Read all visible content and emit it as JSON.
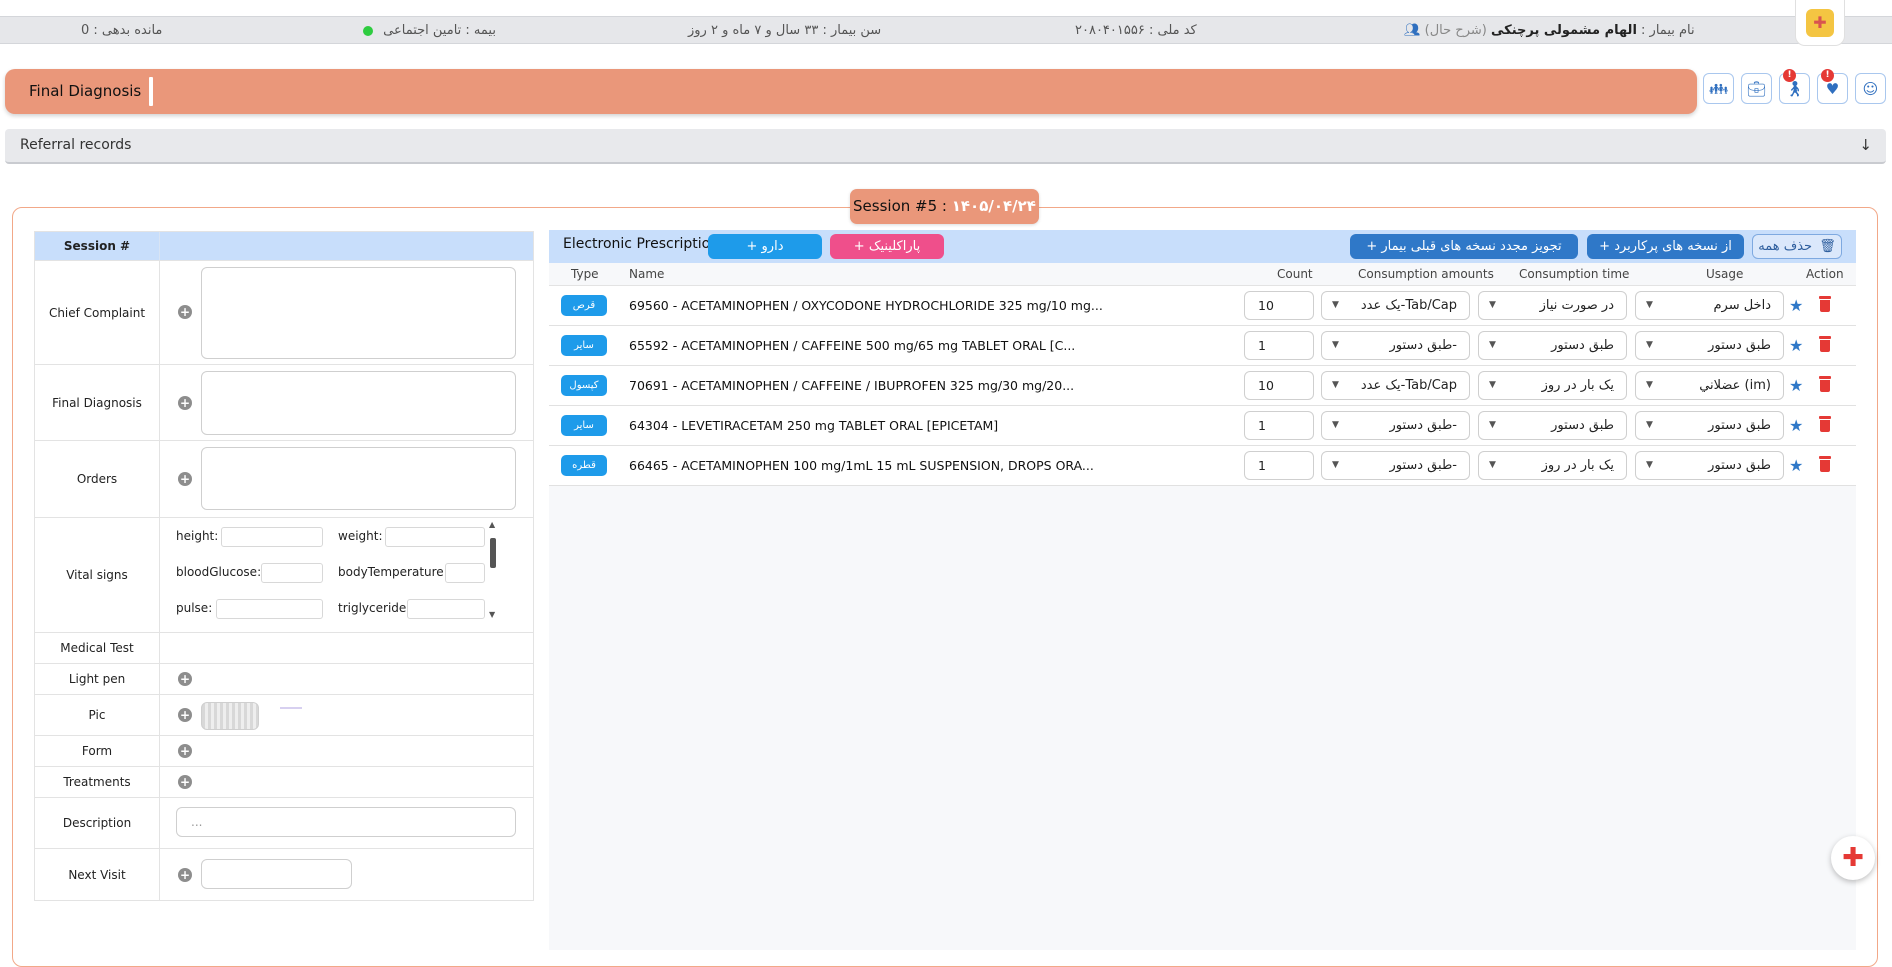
{
  "header": {
    "patient_name_label": "نام بیمار :",
    "patient_name": "الهام مشمولی پرچنکی",
    "history_link": "(شرح حال)",
    "national_code_label": "کد ملی :",
    "national_code": "۲۰۸۰۴۰۱۵۵۶",
    "age_label": "سن بیمار :",
    "age": "۳۳ سال و ۷ ماه و ۲ روز",
    "insurance_label": "بیمه :",
    "insurance": "تامین اجتماعی",
    "debt_label": "مانده بدهی :",
    "debt": "0"
  },
  "diagnosis_bar": {
    "title": "Final Diagnosis"
  },
  "toolbar_icons": [
    {
      "icon": "family-icon",
      "badge": ""
    },
    {
      "icon": "medical-kit-icon",
      "badge": ""
    },
    {
      "icon": "patient-walk-icon",
      "badge": "!"
    },
    {
      "icon": "health-icon",
      "badge": "!"
    },
    {
      "icon": "doctor-icon",
      "badge": ""
    }
  ],
  "referral": {
    "title": "Referral records",
    "arrow": "↓"
  },
  "session": {
    "label": "Session #5 :",
    "date": "۱۴۰۵/۰۴/۲۴"
  },
  "left_table": {
    "header": "Session #",
    "rows": {
      "chief_complaint": "Chief Complaint",
      "final_diagnosis": "Final Diagnosis",
      "orders": "Orders",
      "vital_signs": "Vital signs",
      "medical_test": "Medical Test",
      "light_pen": "Light pen",
      "pic": "Pic",
      "form": "Form",
      "treatments": "Treatments",
      "description": "Description",
      "next_visit": "Next Visit"
    },
    "vitals": {
      "height": "height:",
      "weight": "weight:",
      "blood_glucose": "bloodGlucose:",
      "body_temperature": "bodyTemperature:",
      "pulse": "pulse:",
      "triglyceride": "triglyceride:"
    },
    "description_placeholder": "..."
  },
  "prescription": {
    "title": "Electronic Prescription",
    "buttons": {
      "drug": "+ دارو",
      "paraclinic": "+ پاراکلینیک",
      "renew": "+ تجویز مجدد نسخه های قبلی بیمار",
      "frequent": "+ از نسخه های پرکاربرد",
      "delete_all": "حذف همه"
    },
    "columns": {
      "type": "Type",
      "name": "Name",
      "count": "Count",
      "amounts": "Consumption amounts",
      "time": "Consumption time",
      "usage": "Usage",
      "action": "Action"
    },
    "rows": [
      {
        "type": "قرص",
        "name": "69560 - ACETAMINOPHEN / OXYCODONE HYDROCHLORIDE 325 mg/10 mg...",
        "count": "10",
        "amount": "Tab/Cap-یک عدد",
        "time": "در صورت نیاز",
        "usage": "داخل سرم"
      },
      {
        "type": "سایر",
        "name": "65592 - ACETAMINOPHEN / CAFFEINE 500 mg/65 mg TABLET ORAL [C...",
        "count": "1",
        "amount": "-طبق دستور",
        "time": "طبق دستور",
        "usage": "طبق دستور"
      },
      {
        "type": "کپسول",
        "name": "70691 - ACETAMINOPHEN / CAFFEINE / IBUPROFEN 325 mg/30 mg/20...",
        "count": "10",
        "amount": "Tab/Cap-یک عدد",
        "time": "یک بار در روز",
        "usage": "(im) عضلاني"
      },
      {
        "type": "سایر",
        "name": "64304 - LEVETIRACETAM 250 mg TABLET ORAL [EPICETAM]",
        "count": "1",
        "amount": "-طبق دستور",
        "time": "طبق دستور",
        "usage": "طبق دستور"
      },
      {
        "type": "قطره",
        "name": "66465 - ACETAMINOPHEN 100 mg/1mL 15 mL SUSPENSION, DROPS ORA...",
        "count": "1",
        "amount": "-طبق دستور",
        "time": "یک بار در روز",
        "usage": "طبق دستور"
      }
    ]
  },
  "colors": {
    "accent": "#ea977a",
    "header_blue": "#c8defb",
    "badge_blue": "#1e9bea",
    "danger": "#e53935",
    "star": "#2f78c8"
  }
}
